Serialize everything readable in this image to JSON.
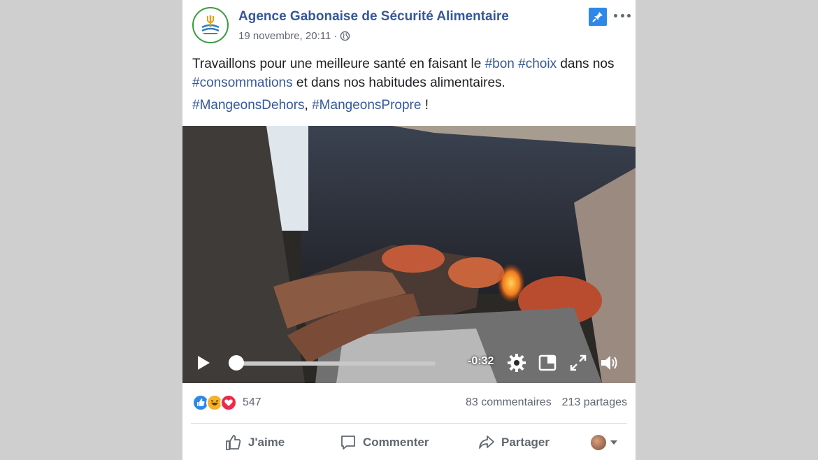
{
  "post": {
    "page_name": "Agence Gabonaise de Sécurité Alimentaire",
    "timestamp": "19 novembre, 20:11",
    "separator": "·",
    "text_part1": "Travaillons pour une meilleure santé en faisant le ",
    "tag_bon": "#bon",
    "tag_choix": "#choix",
    "text_part2": " dans nos ",
    "tag_consommations": "#consommations",
    "text_part3": " et dans nos habitudes alimentaires.",
    "tag_dehors": "#MangeonsDehors",
    "comma": ", ",
    "tag_propre": "#MangeonsPropre",
    "exclaim": " !"
  },
  "video": {
    "time_remaining": "-0:32",
    "progress": 0.02
  },
  "stats": {
    "reaction_count": "547",
    "comments": "83 commentaires",
    "shares": "213 partages"
  },
  "actions": {
    "like": "J'aime",
    "comment": "Commenter",
    "share": "Partager"
  },
  "colors": {
    "link": "#365899",
    "pin": "#2d88e8",
    "like": "#2d88e8",
    "haha": "#f7b125",
    "love": "#f0284a"
  },
  "icons": [
    "globe-icon",
    "pin-icon",
    "more-icon",
    "play-icon",
    "settings-icon",
    "pip-icon",
    "fullscreen-icon",
    "volume-icon",
    "like-icon",
    "comment-icon",
    "share-icon"
  ]
}
